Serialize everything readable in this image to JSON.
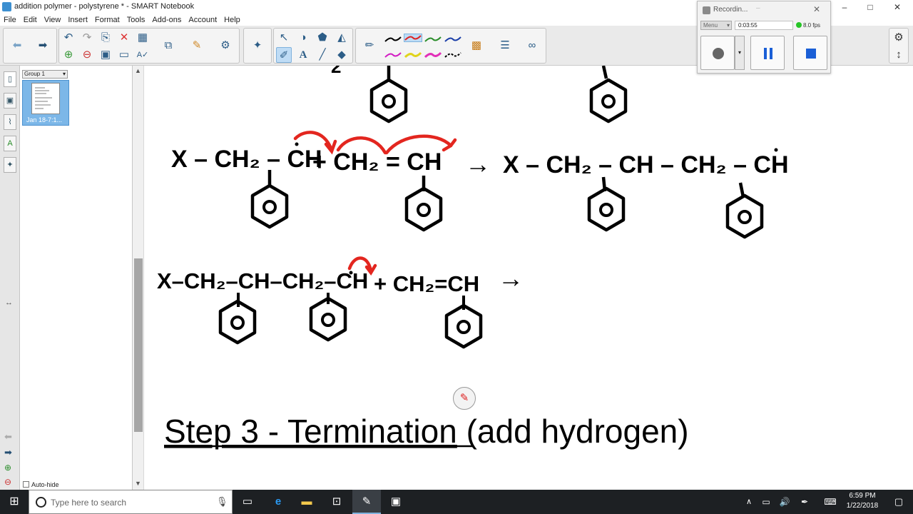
{
  "window": {
    "title": "addition polymer - polystyrene * - SMART Notebook",
    "controls": [
      "–",
      "□",
      "✕"
    ]
  },
  "menu": [
    "File",
    "Edit",
    "View",
    "Insert",
    "Format",
    "Tools",
    "Add-ons",
    "Account",
    "Help"
  ],
  "sorter": {
    "group_label": "Group 1",
    "thumb_label": "Jan 18-7:1..."
  },
  "autohide": {
    "label": "Auto-hide",
    "checked": false
  },
  "recorder": {
    "title": "Recordin...",
    "menu_label": "Menu",
    "time": "0:03:55",
    "fps": "8.0 fps"
  },
  "page": {
    "line1_right_partial": "2",
    "eq1_left": "X – CH₂ – CH",
    "eq1_reactant": "+ CH₂ = CH",
    "eq1_arrow": "→",
    "eq1_product": "X – CH₂ – CH – CH₂ – CH",
    "eq2_left": "X–CH₂–CH–CH₂–CH",
    "eq2_reactant": "+ CH₂=CH",
    "eq2_arrow": "→",
    "ring_letter": "O",
    "heading_underlined": "Step 3 - Termination",
    "heading_rest": " (add hydrogen)"
  },
  "taskbar": {
    "search_placeholder": "Type here to search",
    "time": "6:59 PM",
    "date": "1/22/2018"
  },
  "colors": {
    "ink": "#000000",
    "red_ink": "#e3261f",
    "toolbar": "#eaeaea",
    "taskbar": "#1d2023",
    "selected_tool": "#bfdcf5"
  }
}
